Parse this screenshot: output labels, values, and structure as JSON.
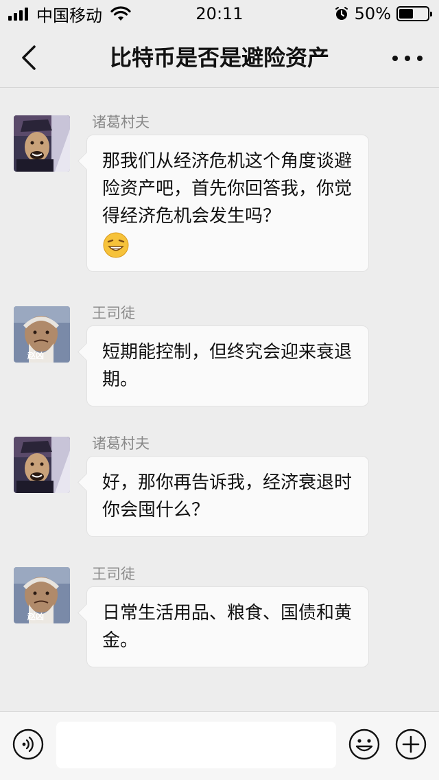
{
  "status_bar": {
    "carrier": "中国移动",
    "time": "20:11",
    "battery": "50%",
    "battery_level": 0.5,
    "icons": [
      "signal-icon",
      "wifi-icon",
      "alarm-icon",
      "battery-icon"
    ]
  },
  "header": {
    "title": "比特币是否是避险资产",
    "back_icon": "chevron-left-icon",
    "more_icon": "more-dots-icon"
  },
  "messages": [
    {
      "sender": "诸葛村夫",
      "text": "那我们从经济危机这个角度谈避险资产吧，首先你回答我，你觉得经济危机会发生吗？",
      "emoji": "grinning-face-emoji"
    },
    {
      "sender": "王司徒",
      "text": "短期能控制，但终究会迎来衰退期。",
      "avatar_caption": "赵凶"
    },
    {
      "sender": "诸葛村夫",
      "text": "好，那你再告诉我，经济衰退时你会囤什么？"
    },
    {
      "sender": "王司徒",
      "text": "日常生活用品、粮食、国债和黄金。",
      "avatar_caption": "赵凶"
    }
  ],
  "input_bar": {
    "placeholder": "",
    "icons": [
      "voice-icon",
      "emoji-icon",
      "plus-icon"
    ]
  },
  "colors": {
    "background": "#ededed",
    "bubble": "#fafafa",
    "sender_name": "#8a8a8a"
  }
}
